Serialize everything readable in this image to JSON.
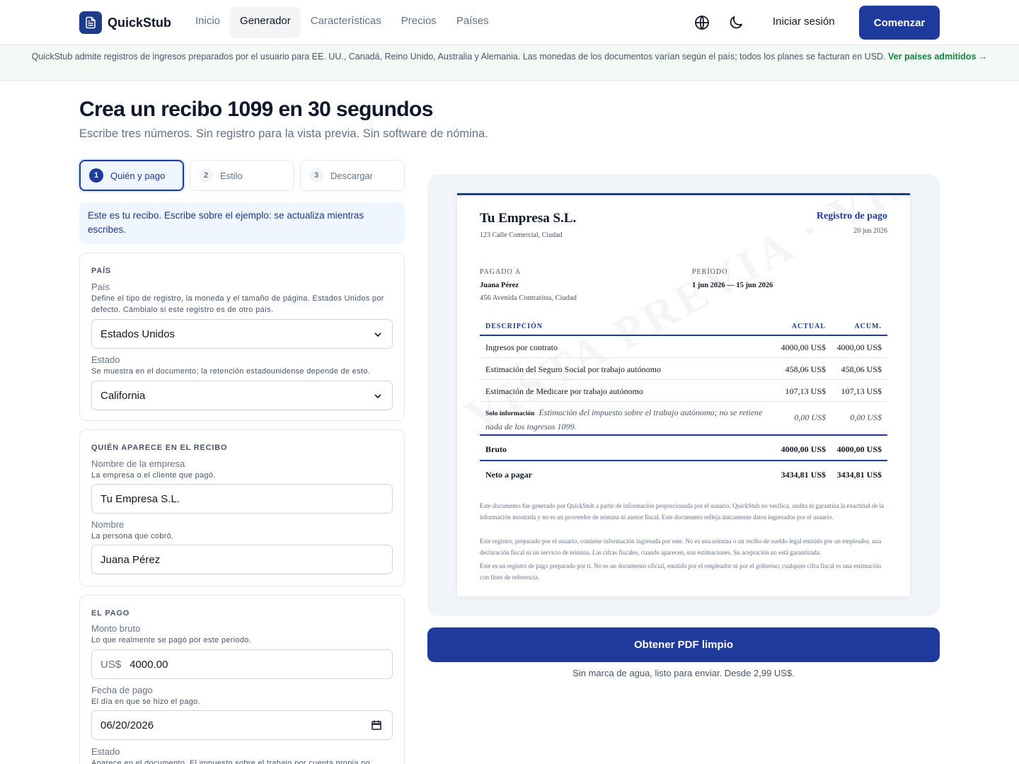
{
  "brand": {
    "name": "QuickStub"
  },
  "nav": {
    "links": [
      "Inicio",
      "Generador",
      "Características",
      "Precios",
      "Países"
    ],
    "signin": "Iniciar sesión",
    "cta": "Comenzar"
  },
  "banner": {
    "text": "QuickStub admite registros de ingresos preparados por el usuario para EE. UU., Canadá, Reino Unido, Australia y Alemania. Las monedas de los documentos varían según el país; todos los planes se facturan en USD.",
    "link": "Ver países admitidos →"
  },
  "hero": {
    "title": "Crea un recibo 1099 en 30 segundos",
    "subtitle": "Escribe tres números. Sin registro para la vista previa. Sin software de nómina."
  },
  "steps": [
    {
      "num": "1",
      "label": "Quién y pago"
    },
    {
      "num": "2",
      "label": "Estilo"
    },
    {
      "num": "3",
      "label": "Descargar"
    }
  ],
  "info": "Este es tu recibo. Escribe sobre el ejemplo: se actualiza mientras escribes.",
  "country_section": {
    "title": "PAÍS",
    "country_label": "País",
    "country_help": "Define el tipo de registro, la moneda y el tamaño de página. Estados Unidos por defecto. Cámbialo si este registro es de otro país.",
    "country_value": "Estados Unidos",
    "state_label": "Estado",
    "state_help": "Se muestra en el documento; la retención estadounidense depende de esto.",
    "state_value": "California"
  },
  "who_section": {
    "title": "QUIÉN APARECE EN EL RECIBO",
    "company_label": "Nombre de la empresa",
    "company_help": "La empresa o el cliente que pagó.",
    "company_value": "Tu Empresa S.L.",
    "name_label": "Nombre",
    "name_help": "La persona que cobró.",
    "name_value": "Juana Pérez"
  },
  "payment_section": {
    "title": "EL PAGO",
    "gross_label": "Monto bruto",
    "gross_help": "Lo que realmente se pagó por este periodo.",
    "currency_prefix": "US$",
    "gross_value": "4000.00",
    "date_label": "Fecha de pago",
    "date_help": "El día en que se hizo el pago.",
    "date_value": "06/20/2026",
    "state_label": "Estado",
    "state_help": "Aparece en el documento. El impuesto sobre el trabajo por cuenta propia no"
  },
  "document": {
    "company": "Tu Empresa S.L.",
    "company_address": "123 Calle Comercial, Ciudad",
    "title": "Registro de pago",
    "date": "20 jun 2026",
    "paid_to_label": "PAGADO A",
    "payee_name": "Juana Pérez",
    "payee_address": "456 Avenida Contratista, Ciudad",
    "period_label": "PERÍODO",
    "period_value": "1 jun 2026 — 15 jun 2026",
    "col_desc": "DESCRIPCIÓN",
    "col_current": "ACTUAL",
    "col_ytd": "ACUM.",
    "rows": [
      {
        "desc": "Ingresos por contrato",
        "current": "4000,00 US$",
        "ytd": "4000,00 US$"
      },
      {
        "desc": "Estimación del Seguro Social por trabajo autónomo",
        "current": "458,06 US$",
        "ytd": "458,06 US$"
      },
      {
        "desc": "Estimación de Medicare por trabajo autónomo",
        "current": "107,13 US$",
        "ytd": "107,13 US$"
      }
    ],
    "note_tag": "Solo información",
    "note_text": "Estimación del impuesto sobre el trabajo autónomo; no se retiene nada de los ingresos 1099.",
    "note_current": "0,00 US$",
    "note_ytd": "0,00 US$",
    "gross_label": "Bruto",
    "gross_current": "4000,00 US$",
    "gross_ytd": "4000,00 US$",
    "net_label": "Neto a pagar",
    "net_current": "3434,81 US$",
    "net_ytd": "3434,81 US$",
    "disclaimers": [
      "Este documento fue generado por QuickStub a partir de información proporcionada por el usuario. QuickStub no verifica, audita ni garantiza la exactitud de la información mostrada y no es un proveedor de nómina ni asesor fiscal. Este documento refleja únicamente datos ingresados por el usuario.",
      "Este registro, preparado por el usuario, contiene información ingresada por este. No es una nómina o un recibo de sueldo legal emitido por un empleador, una declaración fiscal ni un servicio de nómina. Las cifras fiscales, cuando aparecen, son estimaciones. Su aceptación no está garantizada.",
      "Este es un registro de pago preparado por ti. No es un documento oficial, emitido por el empleador ni por el gobierno; cualquier cifra fiscal es una estimación con fines de referencia."
    ],
    "watermark": "VISTA PREVIA · VISTA PREVIA"
  },
  "pdf_button": "Obtener PDF limpio",
  "pdf_note": "Sin marca de agua, listo para enviar. Desde 2,99 US$.",
  "colors": {
    "primary": "#1e3a9a",
    "banner_bg": "#f3faf5",
    "link_green": "#15803d"
  }
}
